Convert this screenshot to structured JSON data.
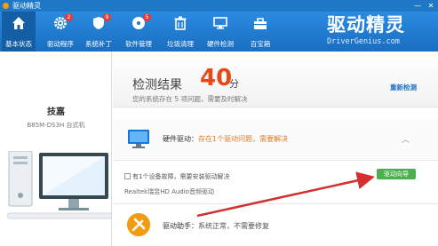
{
  "window": {
    "title": "驱动精灵",
    "controls": [
      "—",
      "✕"
    ]
  },
  "nav": {
    "items": [
      {
        "label": "基本状态",
        "icon": "home-icon",
        "badge": ""
      },
      {
        "label": "驱动程序",
        "icon": "gear-icon",
        "badge": "2"
      },
      {
        "label": "系统补丁",
        "icon": "shield-icon",
        "badge": "9"
      },
      {
        "label": "软件管理",
        "icon": "disc-icon",
        "badge": "5"
      },
      {
        "label": "垃圾清理",
        "icon": "trash-icon",
        "badge": ""
      },
      {
        "label": "硬件检测",
        "icon": "monitor-icon",
        "badge": ""
      },
      {
        "label": "百宝箱",
        "icon": "toolbox-icon",
        "badge": ""
      }
    ],
    "brand_logo": "驱动精灵",
    "brand_url": "DriverGenius.com"
  },
  "left": {
    "brand": "技嘉",
    "model": "B85M-DS3H 台式机"
  },
  "summary": {
    "title": "检测结果",
    "score": "40",
    "score_unit": "分",
    "subtitle": "您的系统存在 5 项问题，需要及时解决",
    "recheck": "重新检测"
  },
  "hardware": {
    "label": "硬件驱动：",
    "status": "存在1个驱动问题，需要解决",
    "issue": "有1个设备故障，需要安装驱动解决",
    "device": "Realtek瑞昱HD Audio音频驱动",
    "fix_button": "驱动向导"
  },
  "assistant": {
    "label": "驱动助手：",
    "status": "系统正常，不需要修复"
  },
  "colors": {
    "nav_blue": "#1f78c6",
    "score_red": "#e64a19",
    "warn_orange": "#e67e22",
    "fix_green": "#4caf50",
    "arrow_red": "#d32f2f"
  }
}
